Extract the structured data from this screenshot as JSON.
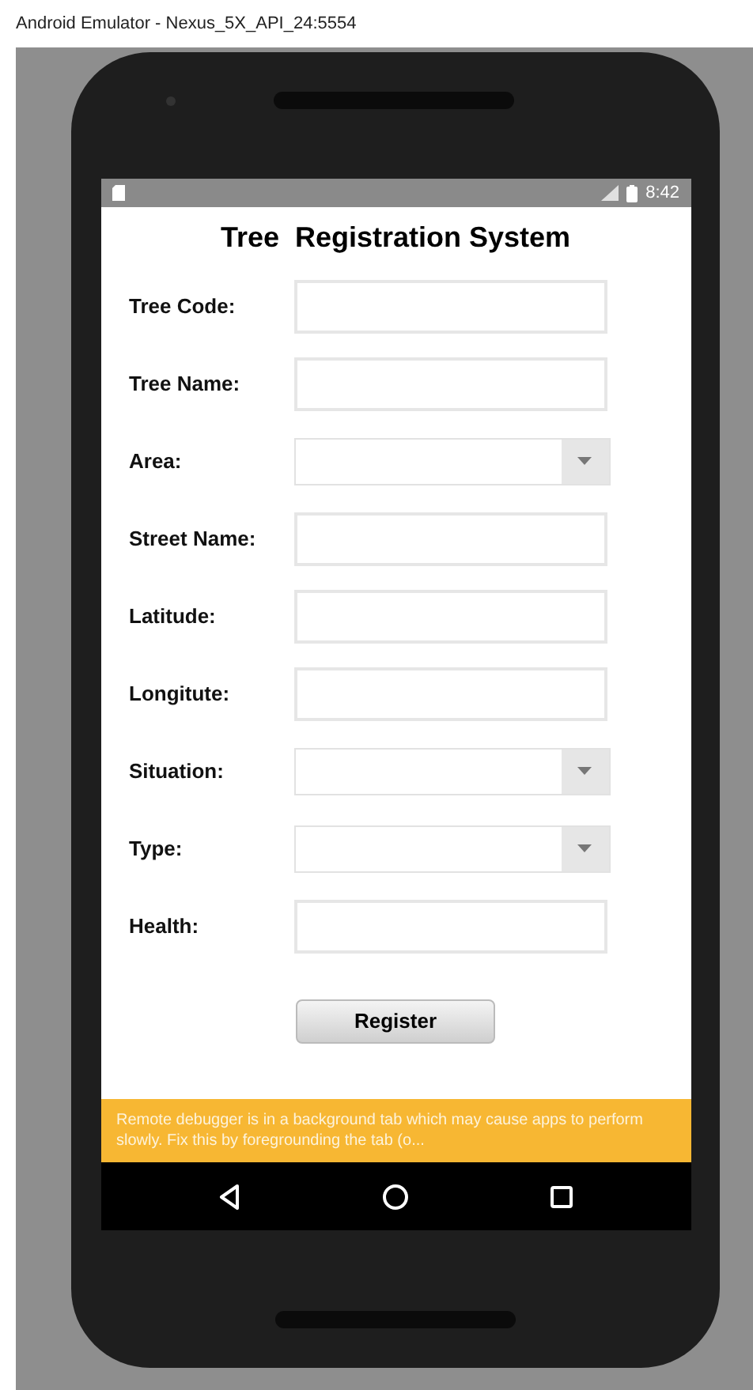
{
  "window": {
    "title": "Android Emulator - Nexus_5X_API_24:5554"
  },
  "status_bar": {
    "time": "8:42"
  },
  "app": {
    "title": "Tree  Registration System",
    "fields": [
      {
        "label": "Tree Code:",
        "kind": "text"
      },
      {
        "label": "Tree Name:",
        "kind": "text"
      },
      {
        "label": "Area:",
        "kind": "dropdown"
      },
      {
        "label": "Street Name:",
        "kind": "text"
      },
      {
        "label": "Latitude:",
        "kind": "text"
      },
      {
        "label": "Longitute:",
        "kind": "text"
      },
      {
        "label": "Situation:",
        "kind": "dropdown"
      },
      {
        "label": "Type:",
        "kind": "dropdown"
      },
      {
        "label": "Health:",
        "kind": "text"
      }
    ],
    "button": "Register"
  },
  "banner": {
    "text": "Remote debugger is in a background tab which may cause apps to perform slowly. Fix this by foregrounding the tab (o..."
  }
}
